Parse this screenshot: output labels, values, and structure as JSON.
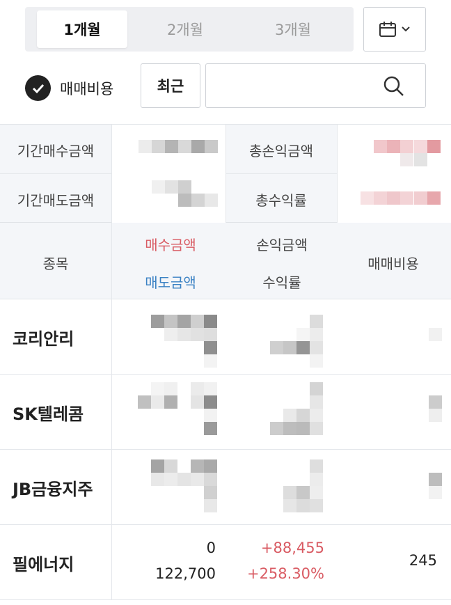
{
  "period_tabs": [
    "1개월",
    "2개월",
    "3개월"
  ],
  "active_period": "1개월",
  "filters": {
    "fee_label": "매매비용",
    "fee_checked": true,
    "recent_label": "최근",
    "search_placeholder": ""
  },
  "summary": {
    "buy_total_label": "기간매수금액",
    "sell_total_label": "기간매도금액",
    "profit_total_label": "총손익금액",
    "return_total_label": "총수익률"
  },
  "table": {
    "col_stock": "종목",
    "col_buy": "매수금액",
    "col_sell": "매도금액",
    "col_profit": "손익금액",
    "col_return": "수익률",
    "col_fee": "매매비용",
    "rows": [
      {
        "name": "코리안리"
      },
      {
        "name": "SK텔레콤"
      },
      {
        "name": "JB금융지주"
      },
      {
        "name": "필에너지",
        "buy": "0",
        "sell": "122,700",
        "profit": "+88,455",
        "return": "+258.30%",
        "fee": "245"
      }
    ]
  },
  "colors": {
    "positive": "#d95b63",
    "sell_blue": "#3b82c4",
    "header_bg": "#f4f6f9"
  }
}
